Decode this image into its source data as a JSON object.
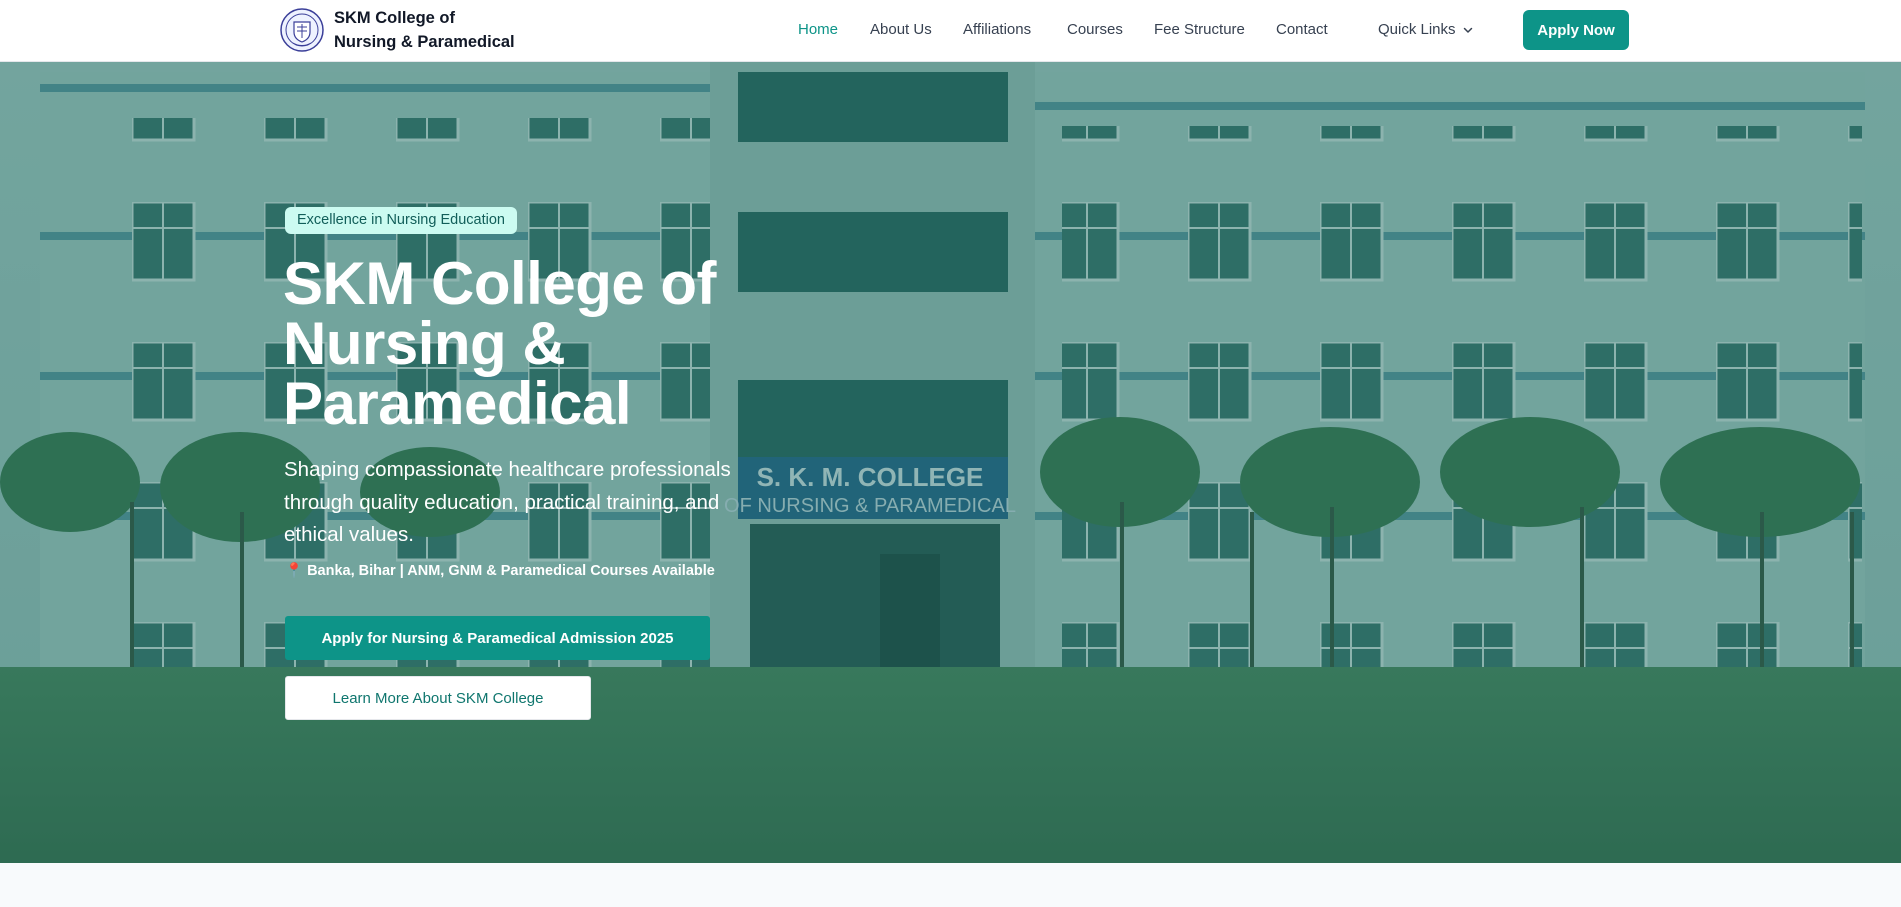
{
  "brand": {
    "name_line1": "SKM College of",
    "name_line2": "Nursing & Paramedical",
    "logo_icon": "college-crest-icon"
  },
  "nav": {
    "items": [
      {
        "label": "Home",
        "active": true
      },
      {
        "label": "About Us"
      },
      {
        "label": "Affiliations"
      },
      {
        "label": "Courses"
      },
      {
        "label": "Fee Structure"
      },
      {
        "label": "Contact"
      }
    ],
    "quick_links": "Quick Links",
    "quick_links_icon": "chevron-down-icon",
    "apply_button": "Apply Now"
  },
  "hero": {
    "badge": "Excellence in Nursing Education",
    "title": "SKM College of Nursing & Paramedical",
    "subtitle": "Shaping compassionate healthcare professionals through quality education, practical training, and ethical values.",
    "location_icon": "map-pin-icon",
    "location": "Banka, Bihar | ANM, GNM & Paramedical Courses Available",
    "building_sign_line1": "S. K. M.  COLLEGE",
    "building_sign_line2": "OF NURSING & PARAMEDICAL",
    "primary_cta": "Apply for Nursing & Paramedical Admission 2025",
    "secondary_cta": "Learn More About SKM College"
  },
  "colors": {
    "accent": "#0d9488",
    "accent_dark": "#0f766e",
    "badge_bg": "#ccfbf1",
    "badge_text": "#115e59"
  }
}
